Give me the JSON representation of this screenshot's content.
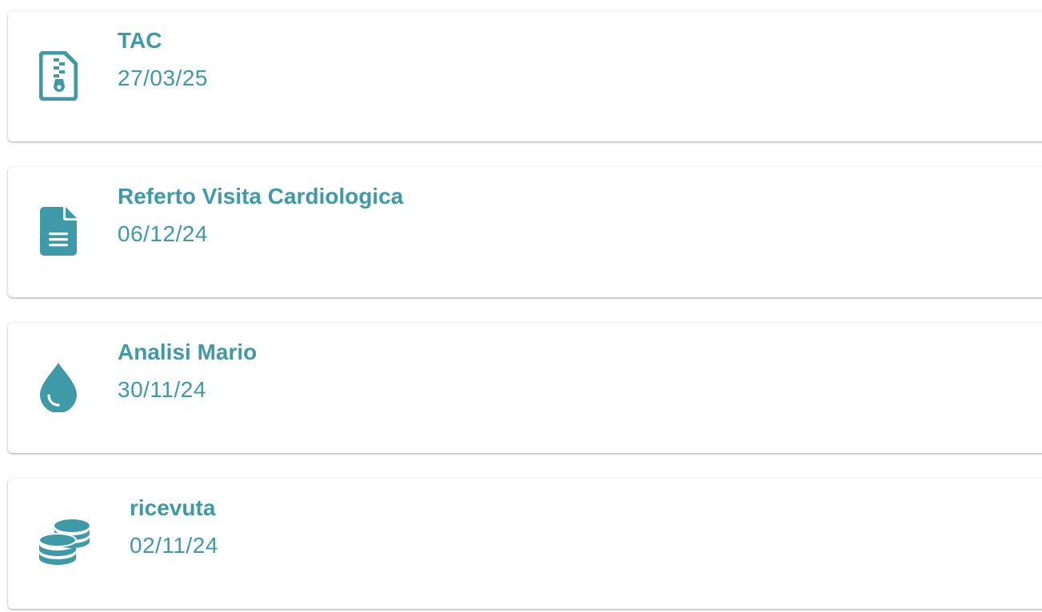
{
  "accent_color": "#3d9aa6",
  "documents": [
    {
      "icon": "file-zipper-icon",
      "title": "TAC",
      "date": "27/03/25"
    },
    {
      "icon": "file-lines-icon",
      "title": "Referto Visita Cardiologica",
      "date": "06/12/24"
    },
    {
      "icon": "droplet-icon",
      "title": "Analisi Mario",
      "date": "30/11/24"
    },
    {
      "icon": "coins-icon",
      "title": "ricevuta",
      "date": "02/11/24"
    }
  ]
}
